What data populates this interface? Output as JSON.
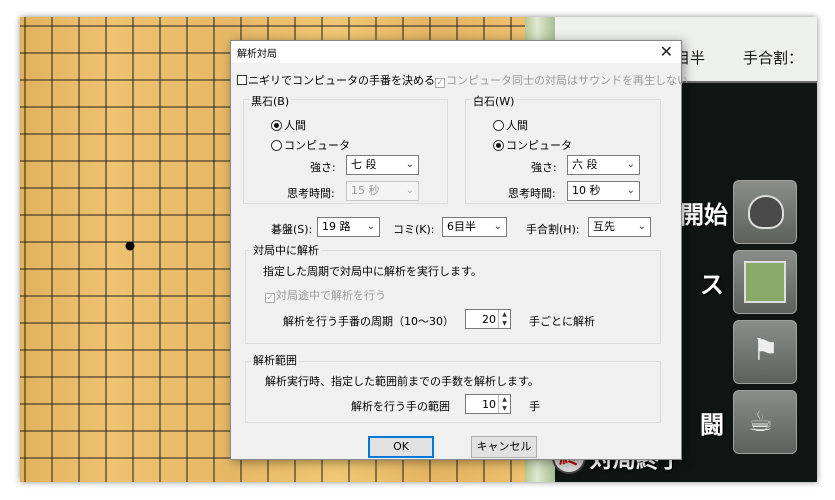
{
  "dialog": {
    "title": "解析対局",
    "close_symbol": "✕",
    "nigiri": {
      "checked": false,
      "label": "ニギリでコンピュータの手番を決める"
    },
    "comp_sound": {
      "checked": true,
      "disabled": true,
      "label": "コンピュータ同士の対局はサウンドを再生しない"
    },
    "black": {
      "title": "黒石(B)",
      "human_label": "人間",
      "computer_label": "コンピュータ",
      "selected": "human",
      "strength_label": "強さ:",
      "strength_value": "七 段",
      "think_label": "思考時間:",
      "think_value": "15 秒"
    },
    "white": {
      "title": "白石(W)",
      "human_label": "人間",
      "computer_label": "コンピュータ",
      "selected": "computer",
      "strength_label": "強さ:",
      "strength_value": "六 段",
      "think_label": "思考時間:",
      "think_value": "10 秒"
    },
    "board_label": "碁盤(S):",
    "board_value": "19 路",
    "komi_label": "コミ(K):",
    "komi_value": "6目半",
    "handicap_label": "手合割(H):",
    "handicap_value": "互先",
    "analysis_during": {
      "title": "対局中に解析",
      "desc": "指定した周期で対局中に解析を実行します。",
      "checkbox_label": "対局途中で解析を行う",
      "period_label": "解析を行う手番の周期（10～30）",
      "period_value": "20",
      "period_suffix": "手ごとに解析"
    },
    "analysis_range": {
      "title": "解析範囲",
      "desc": "解析実行時、指定した範囲前までの手数を解析します。",
      "range_label": "解析を行う手の範囲",
      "range_value": "10",
      "range_suffix": "手"
    },
    "ok_label": "OK",
    "cancel_label": "キャンセル"
  },
  "background": {
    "info_top_text": "",
    "info_komi": "目半",
    "info_handicap": "手合割：",
    "tile_start": "開始",
    "tile_x": "ス",
    "tile_fight": "闘",
    "end_label": "対局終了",
    "end_icon_glyph": "終"
  }
}
